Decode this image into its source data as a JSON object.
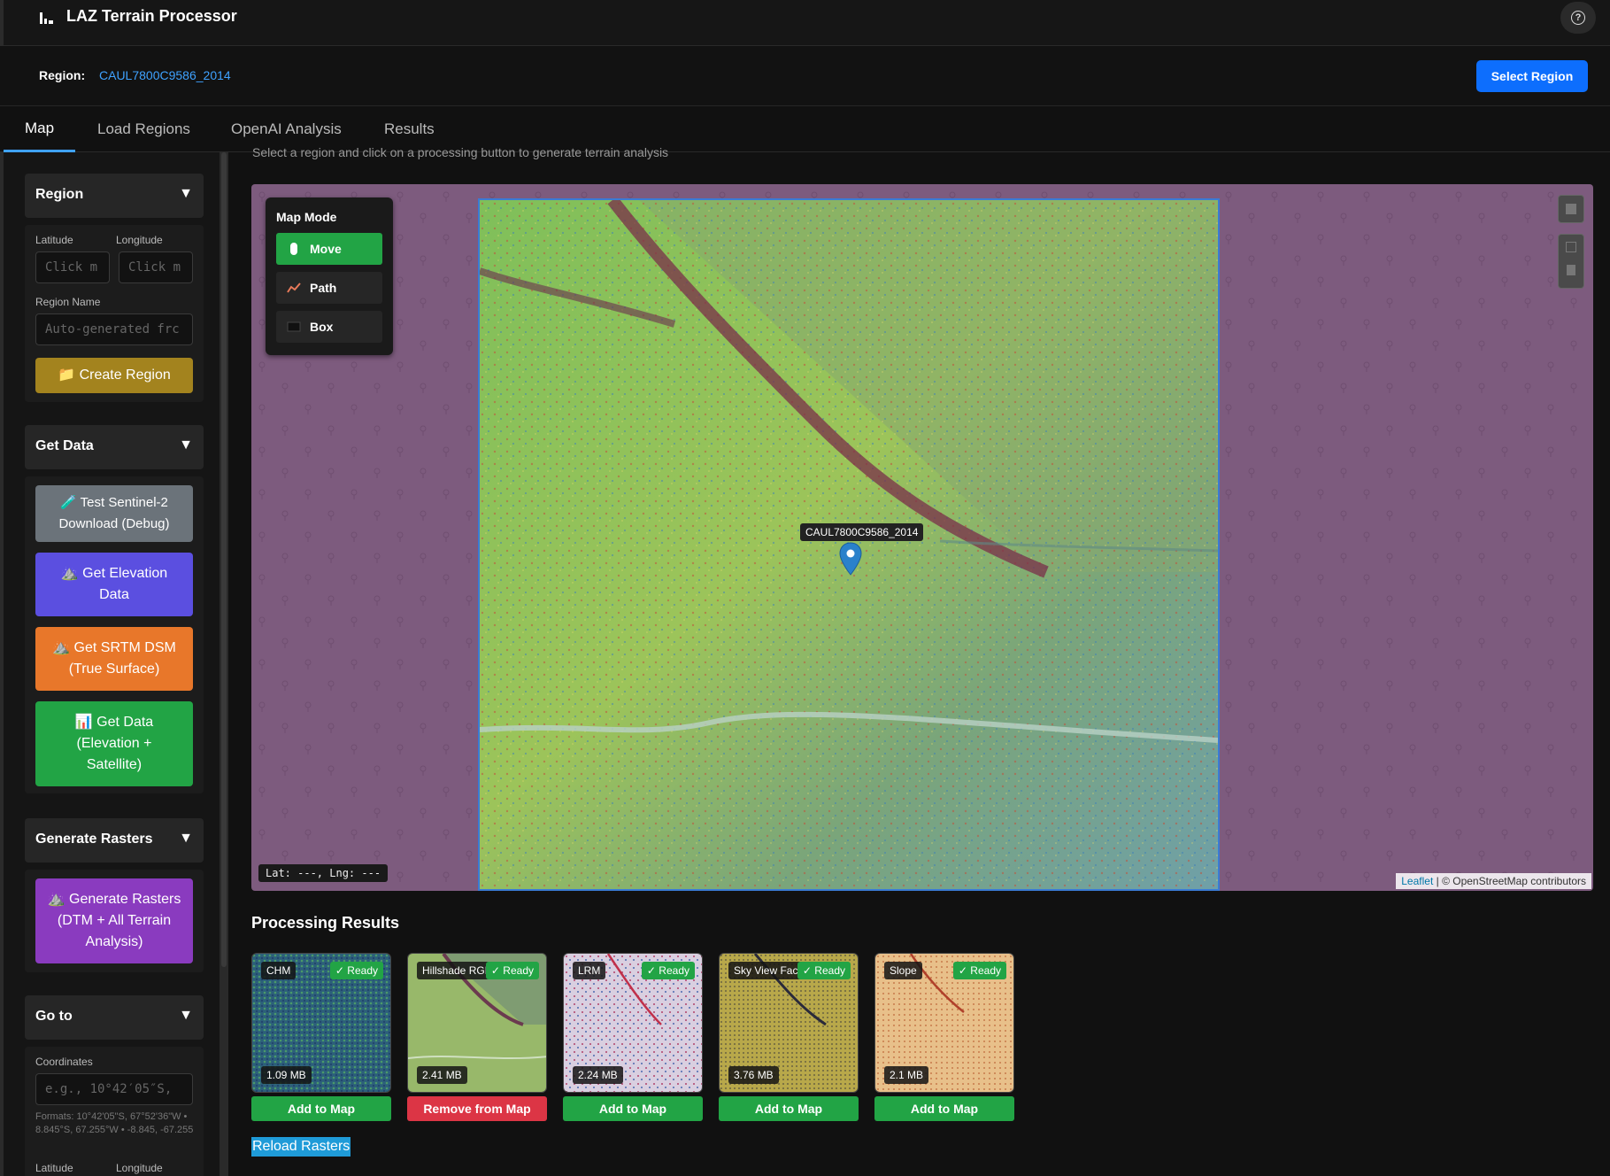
{
  "app": {
    "title": "LAZ Terrain Processor",
    "help_icon": "question-circle-icon"
  },
  "region_bar": {
    "label": "Region:",
    "value": "CAUL7800C9586_2014",
    "select_button": "Select Region"
  },
  "tabs": [
    {
      "label": "Map",
      "active": true
    },
    {
      "label": "Load Regions",
      "active": false
    },
    {
      "label": "OpenAI Analysis",
      "active": false
    },
    {
      "label": "Results",
      "active": false
    }
  ],
  "sidebar": {
    "region": {
      "title": "Region",
      "arrow": "▼",
      "latitude_label": "Latitude",
      "longitude_label": "Longitude",
      "latitude_placeholder": "Click m",
      "longitude_placeholder": "Click m",
      "name_label": "Region Name",
      "name_placeholder": "Auto-generated frc",
      "create_button": "📁 Create Region"
    },
    "get_data": {
      "title": "Get Data",
      "arrow": "▼",
      "test_button": "🧪 Test Sentinel-2 Download (Debug)",
      "elevation_button": "⛰️ Get Elevation Data",
      "srtm_button": "⛰️ Get SRTM DSM (True Surface)",
      "combined_button": "📊 Get Data (Elevation + Satellite)"
    },
    "generate_rasters": {
      "title": "Generate Rasters",
      "arrow": "▼",
      "generate_button": "⛰️ Generate Rasters (DTM + All Terrain Analysis)"
    },
    "go_to": {
      "title": "Go to",
      "arrow": "▼",
      "coordinates_label": "Coordinates",
      "coordinates_placeholder": "e.g., 10°42′05″S,",
      "formats_note": "Formats: 10°42'05\"S, 67°52'36\"W • 8.845°S, 67.255°W • -8.845, -67.255",
      "latitude_label": "Latitude",
      "longitude_label": "Longitude"
    }
  },
  "main": {
    "hint": "Select a region and click on a processing button to generate terrain analysis",
    "map": {
      "mode_title": "Map Mode",
      "modes": [
        {
          "label": "Move",
          "icon": "hand-icon",
          "active": true
        },
        {
          "label": "Path",
          "icon": "path-icon",
          "active": false
        },
        {
          "label": "Box",
          "icon": "box-icon",
          "active": false
        }
      ],
      "marker_label": "CAUL7800C9586_2014",
      "coords_readout": "Lat: ---, Lng: ---",
      "attribution_leaflet": "Leaflet",
      "attribution_rest": "| © OpenStreetMap contributors"
    },
    "results_title": "Processing Results",
    "results": [
      {
        "name": "CHM",
        "status": "✓ Ready",
        "size": "1.09 MB",
        "button": "Add to Map",
        "button_color": "#22a445"
      },
      {
        "name": "Hillshade RGB",
        "status": "✓ Ready",
        "size": "2.41 MB",
        "button": "Remove from Map",
        "button_color": "#dc3545"
      },
      {
        "name": "LRM",
        "status": "✓ Ready",
        "size": "2.24 MB",
        "button": "Add to Map",
        "button_color": "#22a445"
      },
      {
        "name": "Sky View Factor",
        "status": "✓ Ready",
        "size": "3.76 MB",
        "button": "Add to Map",
        "button_color": "#22a445"
      },
      {
        "name": "Slope",
        "status": "✓ Ready",
        "size": "2.1 MB",
        "button": "Add to Map",
        "button_color": "#22a445"
      }
    ],
    "reload_button": "Reload Rasters"
  },
  "colors": {
    "accent": "#0d6efd",
    "link": "#3fa2ff",
    "success": "#22a445",
    "danger": "#dc3545",
    "create_region": "#a3831e",
    "test_button": "#6b737a",
    "elevation_button": "#5b4fe0",
    "srtm_button": "#e8772a",
    "combined_button": "#22a445",
    "generate_button": "#8a3bbf",
    "map_background": "#7d5b7e"
  }
}
